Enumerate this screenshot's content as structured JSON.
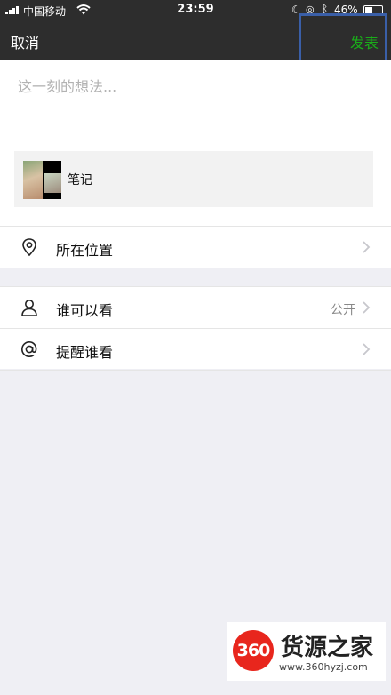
{
  "status_bar": {
    "carrier": "中国移动",
    "time": "23:59",
    "battery_percent": "46%",
    "battery_level": 0.46
  },
  "nav": {
    "cancel_label": "取消",
    "publish_label": "发表",
    "publish_color": "#1aad19"
  },
  "composer": {
    "placeholder": "这一刻的想法...",
    "value": ""
  },
  "attachment": {
    "label": "笔记"
  },
  "location": {
    "label": "所在位置",
    "icon": "location-pin-icon"
  },
  "visibility": {
    "label": "谁可以看",
    "value": "公开",
    "icon": "person-icon"
  },
  "mention": {
    "label": "提醒谁看",
    "icon": "at-icon"
  },
  "watermark": {
    "logo_text": "360",
    "name": "货源之家",
    "url": "www.360hyzj.com"
  }
}
